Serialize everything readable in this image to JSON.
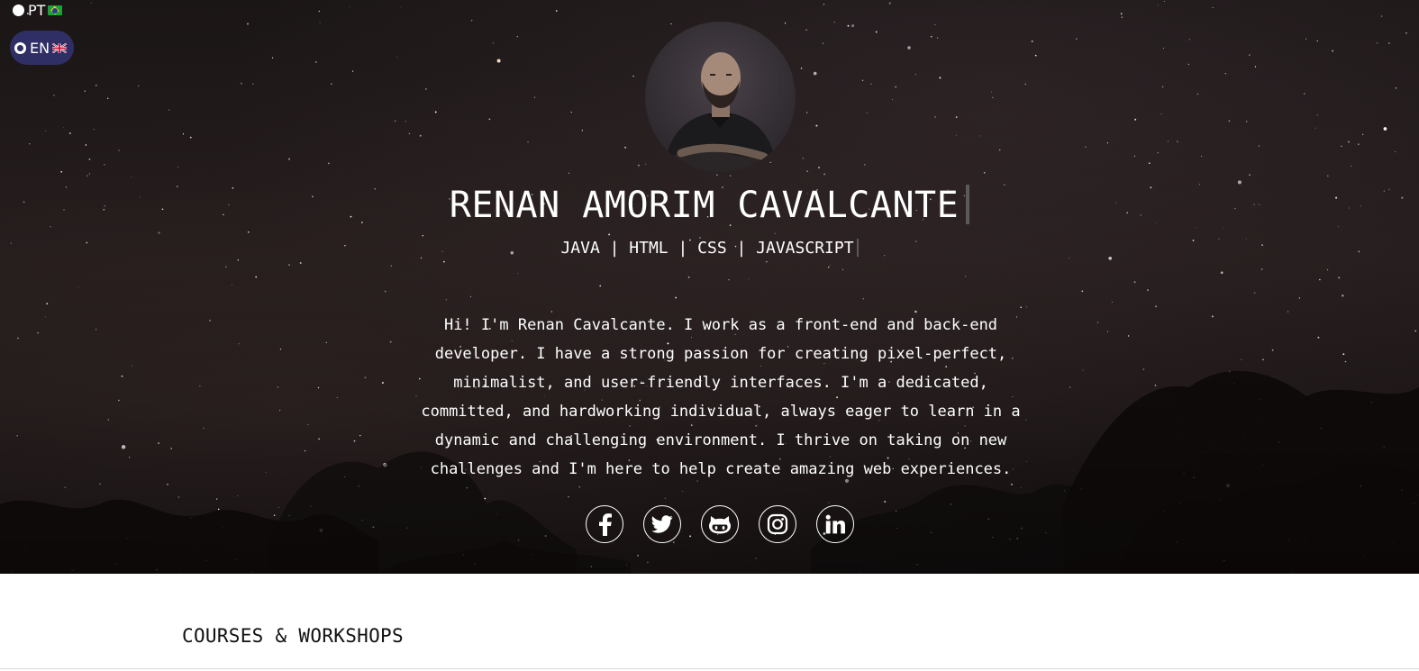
{
  "language_switcher": {
    "options": [
      {
        "code": "PT",
        "flag": "brazil-flag-icon",
        "selected": false
      },
      {
        "code": "EN",
        "flag": "uk-flag-icon",
        "selected": true
      }
    ],
    "active_color": "#2f2f66"
  },
  "profile": {
    "name": "RENAN AMORIM CAVALCANTE",
    "skills": "JAVA | HTML | CSS | JAVASCRIPT",
    "bio": "Hi! I'm Renan Cavalcante. I work as a front-end and back-end developer. I have a strong passion for creating pixel-perfect, minimalist, and user-friendly interfaces. I'm a dedicated, committed, and hardworking individual, always eager to learn in a dynamic and challenging environment. I thrive on taking on new challenges and I'm here to help create amazing web experiences."
  },
  "social_links": [
    {
      "icon": "facebook-icon"
    },
    {
      "icon": "twitter-icon"
    },
    {
      "icon": "github-icon"
    },
    {
      "icon": "instagram-icon"
    },
    {
      "icon": "linkedin-icon"
    }
  ],
  "sections": {
    "courses_title": "COURSES & WORKSHOPS"
  },
  "colors": {
    "hero_background": "#1e1717",
    "text_on_hero": "#ffffff",
    "section_text": "#111111"
  }
}
